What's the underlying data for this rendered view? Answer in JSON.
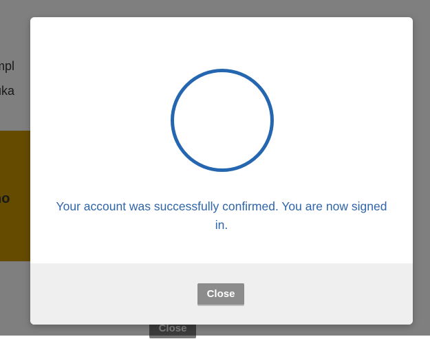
{
  "background": {
    "text_line_1": "mpl",
    "text_line_2": "uka",
    "banner_text": "no",
    "close_label": "Close",
    "banner_color": "#c99700"
  },
  "modal": {
    "status_icon": "circle-outline-icon",
    "message": "Your account was successfully confirmed. You are now signed in.",
    "close_label": "Close",
    "accent_color": "#2566b0"
  }
}
